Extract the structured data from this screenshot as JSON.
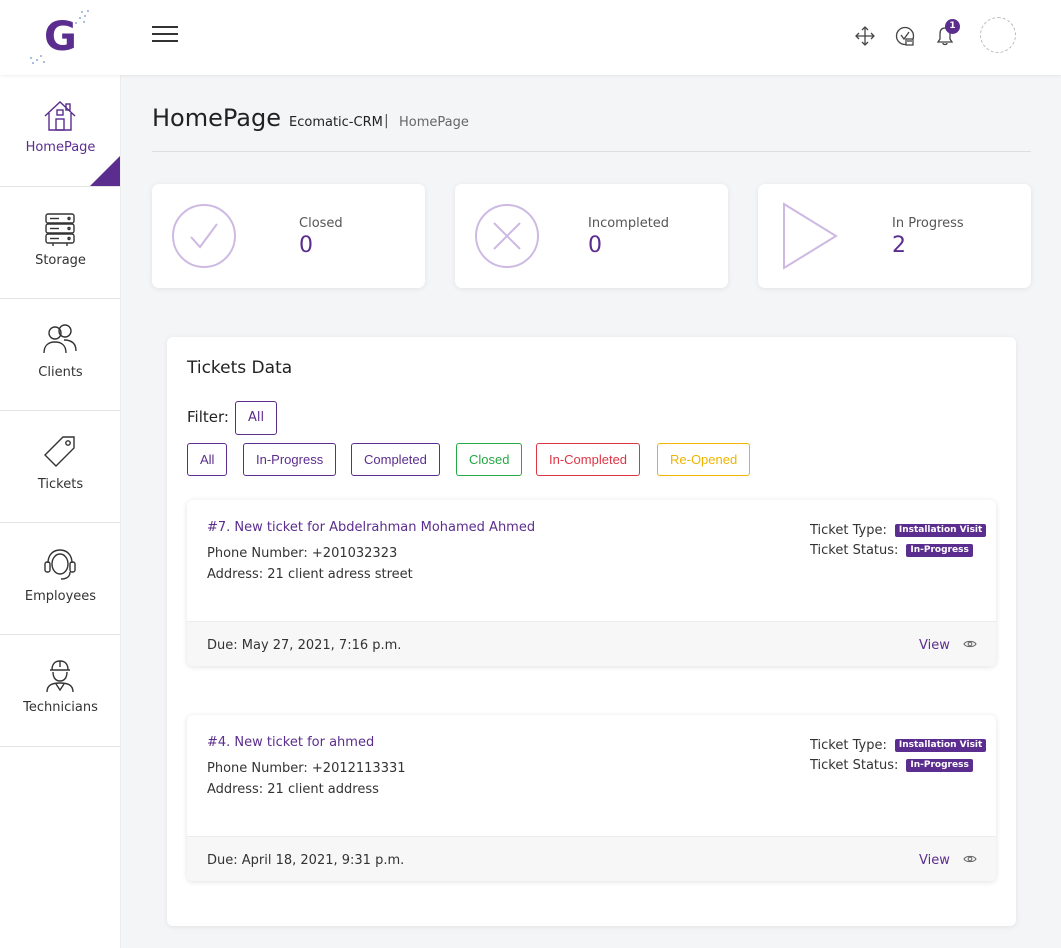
{
  "app": {
    "logo_letter": "G",
    "brand_color": "#5b2d8e",
    "notification_count": "1"
  },
  "sidebar": {
    "items": [
      {
        "label": "HomePage",
        "icon": "home-icon",
        "active": true
      },
      {
        "label": "Storage",
        "icon": "server-icon"
      },
      {
        "label": "Clients",
        "icon": "users-icon"
      },
      {
        "label": "Tickets",
        "icon": "tag-icon"
      },
      {
        "label": "Employees",
        "icon": "headset-icon"
      },
      {
        "label": "Technicians",
        "icon": "worker-helmet-icon"
      }
    ]
  },
  "header": {
    "title": "HomePage",
    "breadcrumb": {
      "home": "Ecomatic-CRM",
      "separator": "|",
      "current": "HomePage"
    }
  },
  "stats": [
    {
      "label": "Closed",
      "value": "0",
      "icon": "check-circle-icon"
    },
    {
      "label": "Incompleted",
      "value": "0",
      "icon": "x-circle-icon"
    },
    {
      "label": "In Progress",
      "value": "2",
      "icon": "play-icon"
    }
  ],
  "tickets_panel": {
    "title": "Tickets Data",
    "filter_label": "Filter:",
    "filter_current": "All",
    "filters": [
      {
        "label": "All",
        "color": "#5b2d8e"
      },
      {
        "label": "In-Progress",
        "color": "#5b2d8e"
      },
      {
        "label": "Completed",
        "color": "#5b2d8e"
      },
      {
        "label": "Closed",
        "color": "#28a745"
      },
      {
        "label": "In-Completed",
        "color": "#dc3545"
      },
      {
        "label": "Re-Opened",
        "color": "#f0b400"
      }
    ],
    "tickets": [
      {
        "title": "#7. New ticket for Abdelrahman Mohamed Ahmed",
        "phone": "Phone Number: +201032323",
        "address": "Address: 21 client adress street",
        "type_label": "Ticket Type:",
        "type_value": "Installation Visit",
        "status_label": "Ticket Status:",
        "status_value": "In-Progress",
        "due": "Due: May 27, 2021, 7:16 p.m.",
        "view_label": "View"
      },
      {
        "title": "#4. New ticket for ahmed",
        "phone": "Phone Number: +2012113331",
        "address": "Address: 21 client address",
        "type_label": "Ticket Type:",
        "type_value": "Installation Visit",
        "status_label": "Ticket Status:",
        "status_value": "In-Progress",
        "due": "Due: April 18, 2021, 9:31 p.m.",
        "view_label": "View"
      }
    ]
  }
}
